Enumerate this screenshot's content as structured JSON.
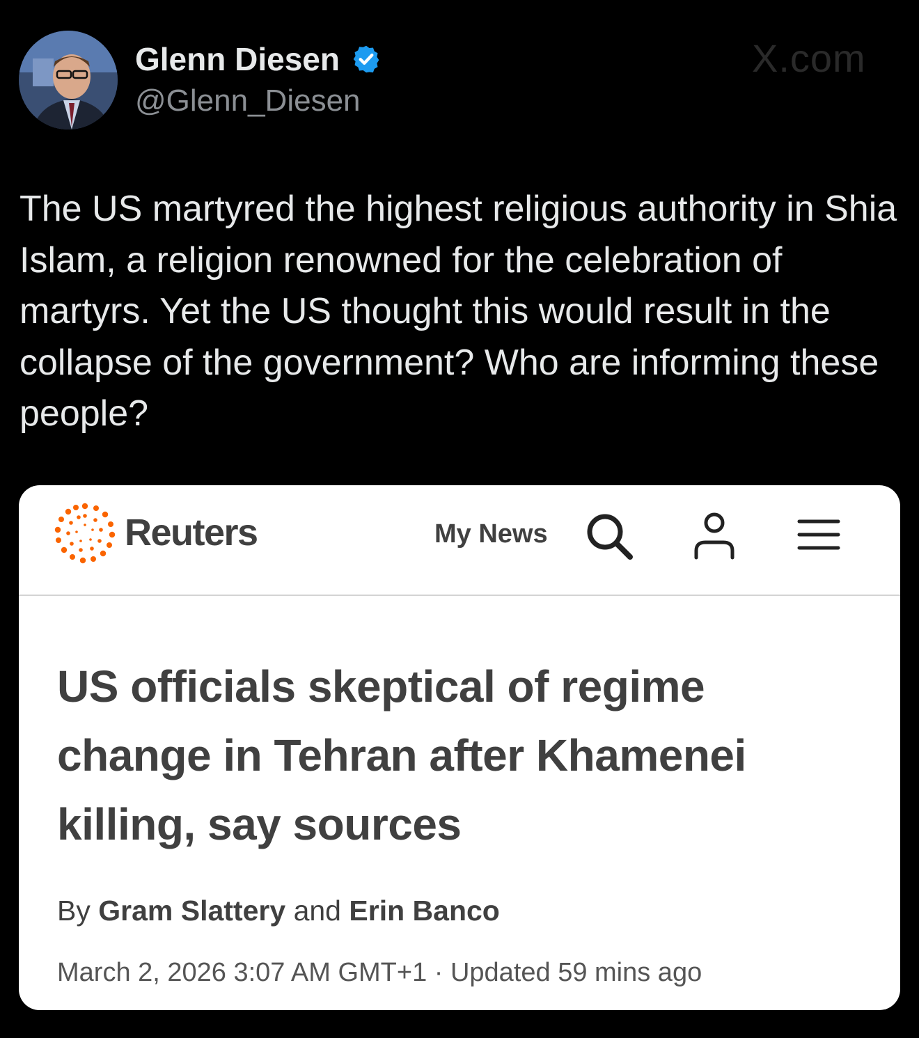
{
  "tweet": {
    "display_name": "Glenn Diesen",
    "handle": "@Glenn_Diesen",
    "watermark": "X.com",
    "text": "The US martyred the highest religious authority in Shia Islam, a religion renowned for the celebration of martyrs. Yet the US thought this would result in the collapse of the government? Who are informing these people?",
    "verified_color": "#1d9bf0"
  },
  "card": {
    "brand": "Reuters",
    "brand_color": "#fa6400",
    "nav_my_news": "My News",
    "headline": "US officials skeptical of regime change in Tehran after Khamenei killing, say sources",
    "byline_prefix": "By",
    "author_1": "Gram Slattery",
    "byline_and": "and",
    "author_2": "Erin Banco",
    "dateline": "March 2, 2026 3:07 AM GMT+1 · Updated 59 mins ago"
  },
  "icons": [
    "verified-badge-icon",
    "reuters-logo-icon",
    "search-icon",
    "user-icon",
    "menu-icon"
  ]
}
